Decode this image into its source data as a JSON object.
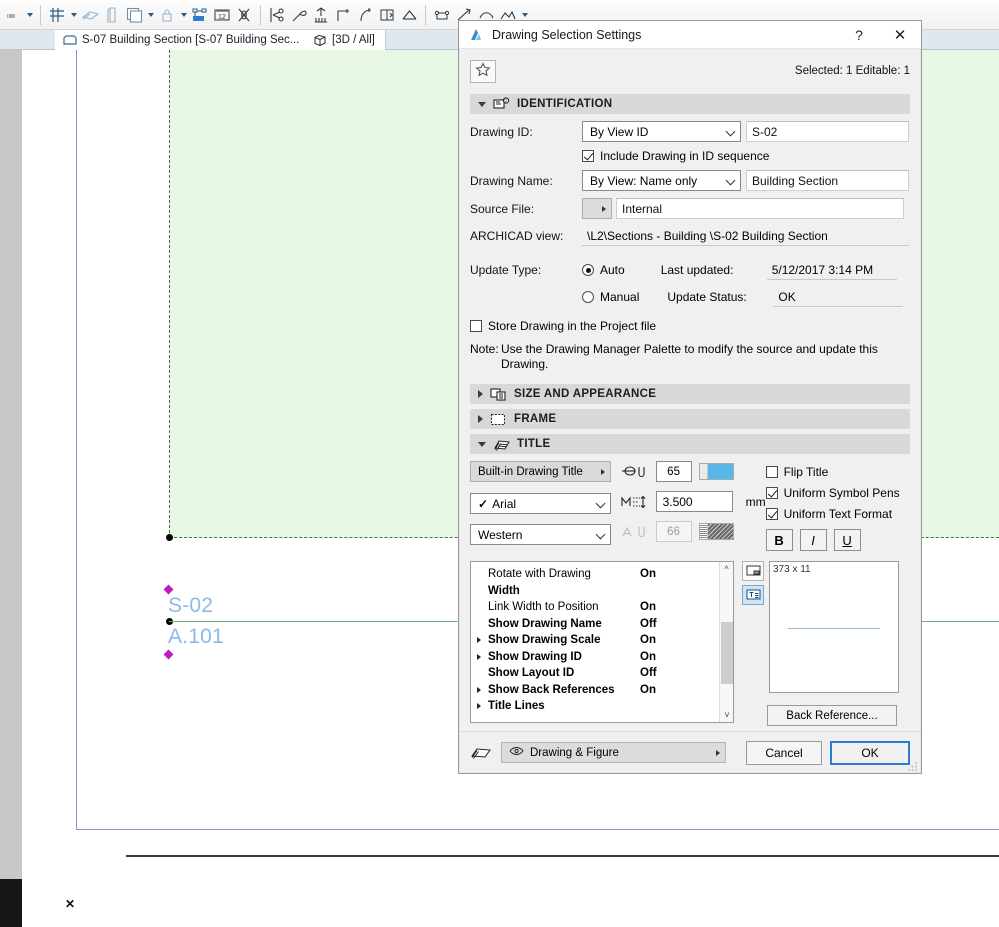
{
  "app": {
    "tabs": [
      {
        "label": "S-07 Building Section [S-07 Building Sec...",
        "icon": "section-window-icon"
      },
      {
        "label": "[3D / All]",
        "icon": "cube-icon"
      }
    ],
    "canvas": {
      "drawing_id_label": "S-02",
      "layout_id_label": "A.101"
    }
  },
  "dialog": {
    "title": "Drawing Selection Settings",
    "help_glyph": "?",
    "close_glyph": "✕",
    "favorites_icon": "star-icon",
    "selection_info": "Selected: 1 Editable: 1",
    "sections": {
      "identification": {
        "label": "IDENTIFICATION",
        "expanded": true,
        "icon": "identification-icon",
        "drawing_id_label": "Drawing ID:",
        "drawing_id_mode": "By View ID",
        "drawing_id_value": "S-02",
        "include_in_sequence_label": "Include Drawing in ID sequence",
        "include_in_sequence_checked": true,
        "drawing_name_label": "Drawing Name:",
        "drawing_name_mode": "By View: Name only",
        "drawing_name_value": "Building Section",
        "source_file_label": "Source File:",
        "source_file_value": "Internal",
        "archicad_view_label": "ARCHICAD view:",
        "archicad_view_value": "\\L2\\Sections - Building \\S-02 Building Section",
        "update_type_label": "Update Type:",
        "update_auto_label": "Auto",
        "update_manual_label": "Manual",
        "update_selected": "Auto",
        "last_updated_label": "Last updated:",
        "last_updated_value": "5/12/2017 3:14 PM",
        "update_status_label": "Update Status:",
        "update_status_value": "OK",
        "store_in_project_label": "Store Drawing in the Project file",
        "store_in_project_checked": false,
        "note_prefix": "Note:",
        "note_text": "Use the Drawing Manager Palette to modify the source and update this Drawing."
      },
      "size_and_appearance": {
        "label": "SIZE AND APPEARANCE",
        "expanded": false,
        "icon": "size-appearance-icon"
      },
      "frame": {
        "label": "FRAME",
        "expanded": false,
        "icon": "frame-icon"
      },
      "title": {
        "label": "TITLE",
        "expanded": true,
        "icon": "title-icon",
        "title_type": "Built-in Drawing Title",
        "font_family": "Arial",
        "font_check": "✓",
        "script": "Western",
        "symbol_pen_icon": "symbol-pen-icon",
        "symbol_pen_number": "65",
        "symbol_pen_color": "#57b6ea",
        "text_size_icon": "text-size-icon",
        "text_size_value": "3.500",
        "text_size_unit": "mm",
        "text_pen_icon": "text-pen-icon",
        "text_pen_number": "66",
        "text_pen_color": "#6a6a6a",
        "flip_title_label": "Flip Title",
        "flip_title_checked": false,
        "uniform_symbol_pens_label": "Uniform Symbol Pens",
        "uniform_symbol_pens_checked": true,
        "uniform_text_format_label": "Uniform Text Format",
        "uniform_text_format_checked": true,
        "bold_label": "B",
        "italic_label": "I",
        "underline_label": "U",
        "parameters": [
          {
            "name": "Rotate with Drawing",
            "value": "On",
            "bold": false,
            "expandable": false
          },
          {
            "name": "Width",
            "value": "",
            "bold": true,
            "expandable": false
          },
          {
            "name": "Link Width to Position",
            "value": "On",
            "bold": false,
            "expandable": false
          },
          {
            "name": "Show Drawing Name",
            "value": "Off",
            "bold": true,
            "expandable": false
          },
          {
            "name": "Show Drawing Scale",
            "value": "On",
            "bold": true,
            "expandable": true
          },
          {
            "name": "Show Drawing ID",
            "value": "On",
            "bold": true,
            "expandable": true
          },
          {
            "name": "Show Layout ID",
            "value": "Off",
            "bold": true,
            "expandable": false
          },
          {
            "name": "Show Back References",
            "value": "On",
            "bold": true,
            "expandable": true
          },
          {
            "name": "Title Lines",
            "value": "",
            "bold": true,
            "expandable": true
          }
        ],
        "preview_dimensions": "373 x 11",
        "preview_tool_2d": "preview-2d-icon",
        "preview_tool_text": "preview-text-icon",
        "back_reference_button": "Back Reference..."
      }
    },
    "footer": {
      "tool_icon": "drawing-tool-icon",
      "layer_icon": "eye-icon",
      "layer_value": "Drawing & Figure",
      "cancel_label": "Cancel",
      "ok_label": "OK"
    }
  }
}
